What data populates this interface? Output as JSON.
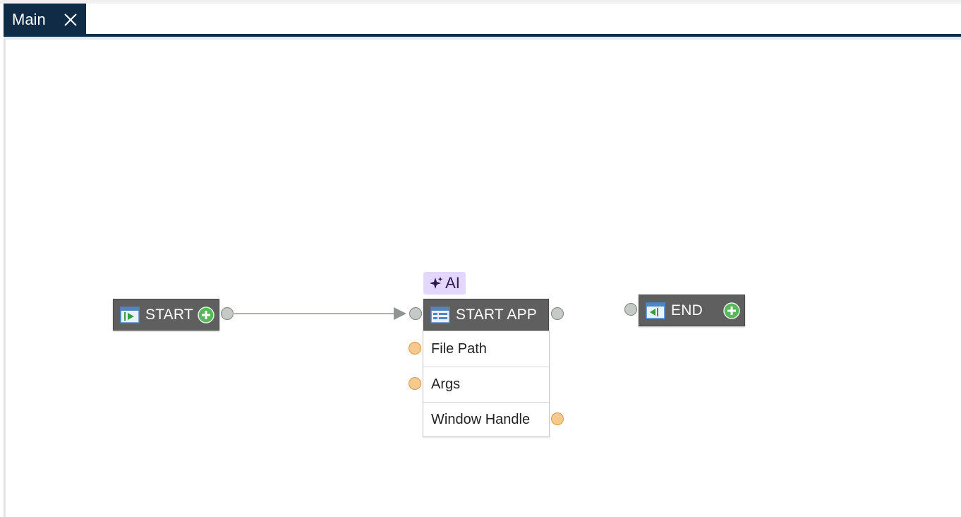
{
  "tabs": [
    {
      "label": "Main",
      "close_icon": "close-icon"
    }
  ],
  "colors": {
    "tab_background": "#0f2b46",
    "node_header": "#5f5f5f",
    "ai_badge": "#e3d7fb",
    "port_gray": "#c5cac7",
    "port_orange": "#f6c98e",
    "add_button": "#4caf50"
  },
  "nodes": {
    "start": {
      "title": "START",
      "icon": "flow-start-icon",
      "add_icon": "add-circle-icon"
    },
    "start_app": {
      "badge": "AI",
      "badge_icon": "sparkle-icon",
      "title": "START APP",
      "icon": "application-icon",
      "params": [
        {
          "label": "File Path"
        },
        {
          "label": "Args"
        },
        {
          "label": "Window Handle"
        }
      ]
    },
    "end": {
      "title": "END",
      "icon": "flow-end-icon",
      "add_icon": "add-circle-icon"
    }
  }
}
